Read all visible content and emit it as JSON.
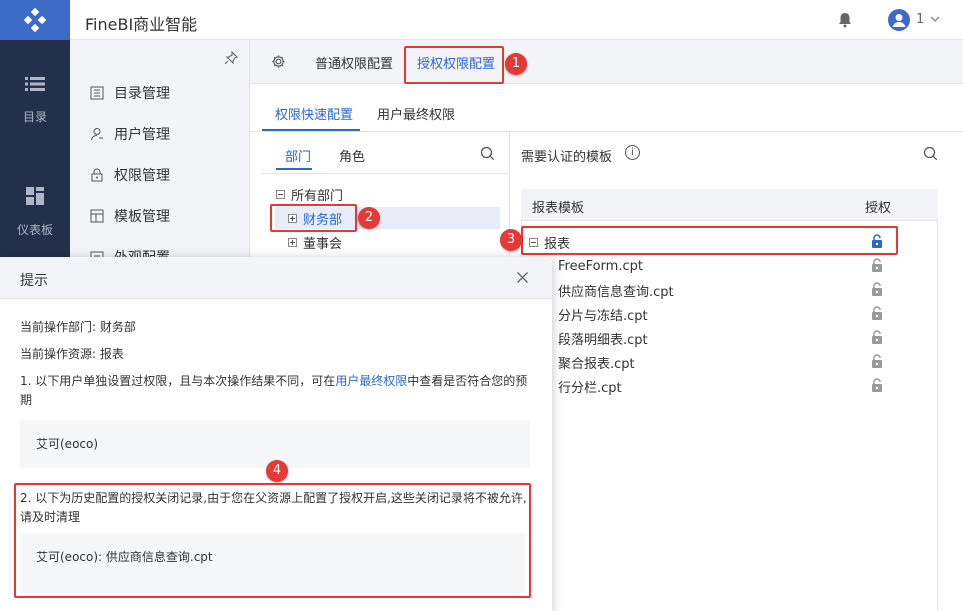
{
  "app": {
    "title": "FineBI商业智能",
    "user": "1"
  },
  "leftnav": [
    {
      "label": "目录",
      "icon": "list-icon"
    },
    {
      "label": "仪表板",
      "icon": "dashboard-icon"
    }
  ],
  "sidemenu": [
    {
      "label": "目录管理",
      "icon": "catalog-icon"
    },
    {
      "label": "用户管理",
      "icon": "user-icon"
    },
    {
      "label": "权限管理",
      "icon": "lock-icon"
    },
    {
      "label": "模板管理",
      "icon": "template-icon"
    },
    {
      "label": "外观配置",
      "icon": "appearance-icon"
    }
  ],
  "top_tabs": {
    "normal": "普通权限配置",
    "grant": "授权权限配置"
  },
  "sub_tabs": {
    "quick": "权限快速配置",
    "final": "用户最终权限"
  },
  "tree_tabs": {
    "dept": "部门",
    "role": "角色"
  },
  "tree": {
    "root": "所有部门",
    "items": [
      "财务部",
      "董事会"
    ]
  },
  "right": {
    "title": "需要认证的模板",
    "col_template": "报表模板",
    "col_grant": "授权",
    "root": "报表",
    "files": [
      "FreeForm.cpt",
      "供应商信息查询.cpt",
      "分片与冻结.cpt",
      "段落明细表.cpt",
      "聚合报表.cpt",
      "行分栏.cpt"
    ]
  },
  "dialog": {
    "title": "提示",
    "line1": "当前操作部门: 财务部",
    "line2": "当前操作资源: 报表",
    "p1_a": "1. 以下用户单独设置过权限，且与本次操作结果不同，可在",
    "p1_link": "用户最终权限",
    "p1_b": "中查看是否符合您的预",
    "p1_c": "期",
    "box1": "艾可(eoco)",
    "p2_a": "2. 以下为历史配置的授权关闭记录,由于您在父资源上配置了授权开启,这些关闭记录将不被允许,",
    "p2_b": "请及时清理",
    "box2": "艾可(eoco): 供应商信息查询.cpt"
  },
  "badges": [
    "1",
    "2",
    "3",
    "4"
  ],
  "colors": {
    "accent": "#2b67d4",
    "nav": "#23304b",
    "annotation": "#e53935"
  }
}
